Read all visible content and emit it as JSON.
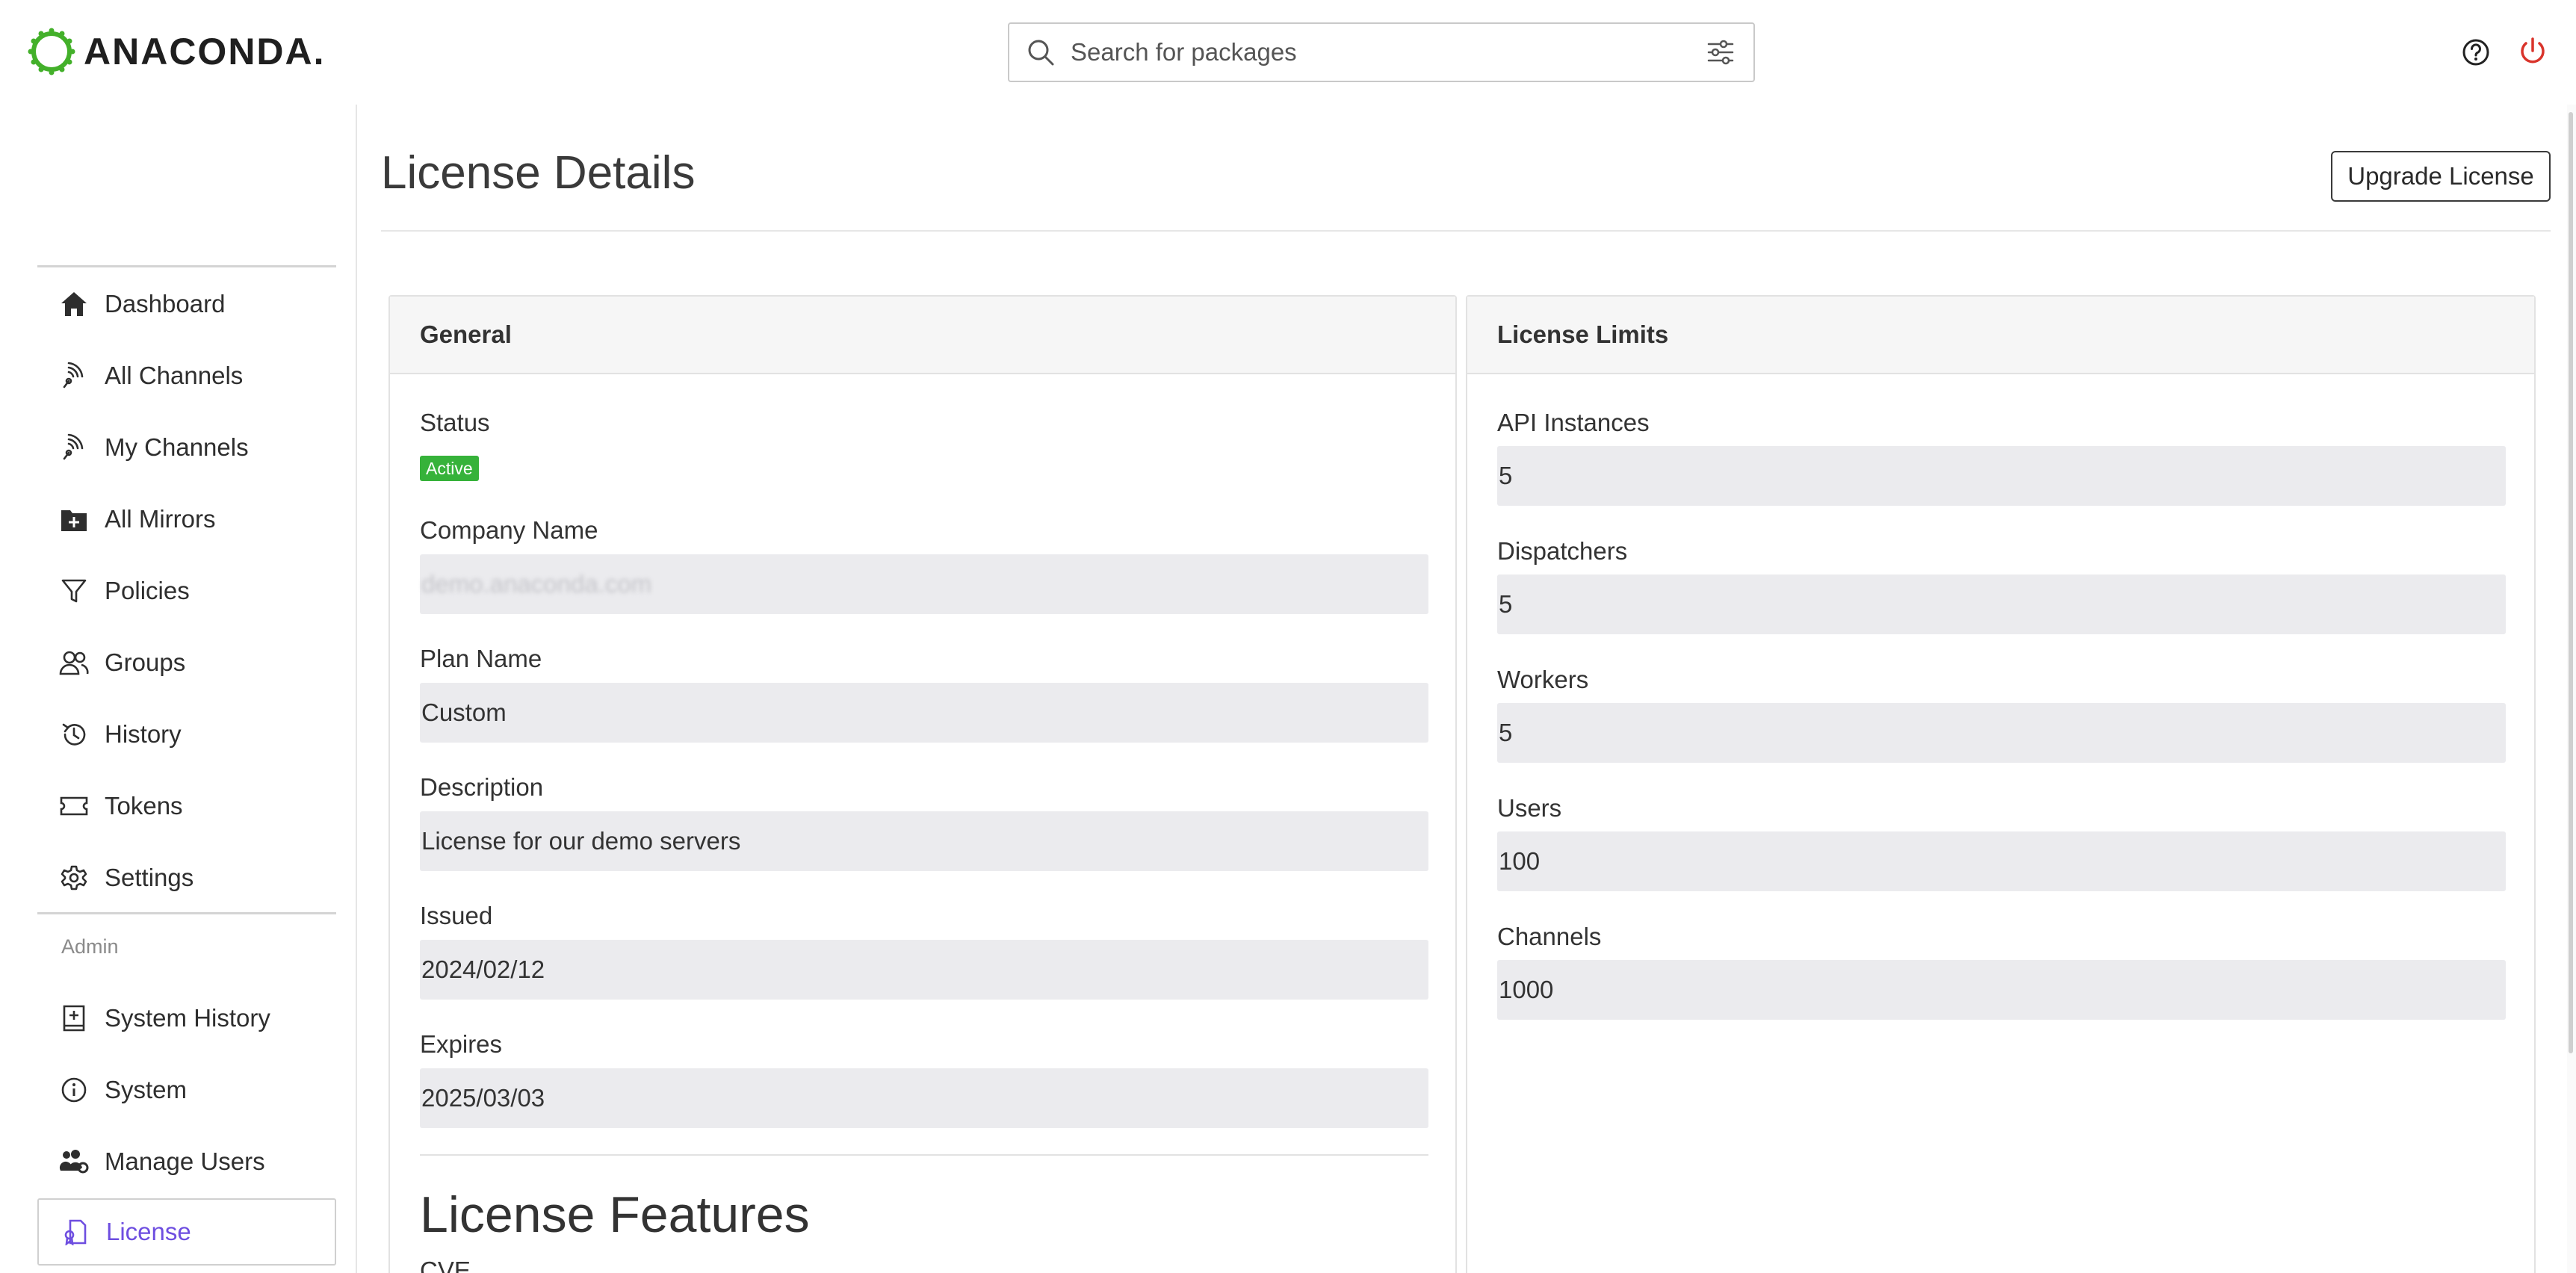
{
  "header": {
    "logo_text": "ANACONDA.",
    "search_placeholder": "Search for packages",
    "icons": {
      "search": "search-icon",
      "filter": "sliders-icon",
      "help": "help-circle-icon",
      "power": "power-icon"
    },
    "power_color": "#d9342b"
  },
  "sidebar": {
    "items": [
      {
        "label": "Dashboard",
        "icon": "home-icon"
      },
      {
        "label": "All Channels",
        "icon": "antenna-icon"
      },
      {
        "label": "My Channels",
        "icon": "antenna-icon"
      },
      {
        "label": "All Mirrors",
        "icon": "folder-plus-icon"
      },
      {
        "label": "Policies",
        "icon": "filter-icon"
      },
      {
        "label": "Groups",
        "icon": "users-icon"
      },
      {
        "label": "History",
        "icon": "history-icon"
      },
      {
        "label": "Tokens",
        "icon": "ticket-icon"
      },
      {
        "label": "Settings",
        "icon": "gear-icon"
      }
    ],
    "admin_label": "Admin",
    "admin_items": [
      {
        "label": "System History",
        "icon": "book-plus-icon"
      },
      {
        "label": "System",
        "icon": "info-icon"
      },
      {
        "label": "Manage Users",
        "icon": "users-cog-icon"
      },
      {
        "label": "License",
        "icon": "license-icon",
        "active": true
      }
    ],
    "active_color": "#6e4ee0"
  },
  "main": {
    "title": "License Details",
    "upgrade_button": "Upgrade License",
    "general": {
      "heading": "General",
      "status_label": "Status",
      "status_badge": "Active",
      "badge_color": "#36b23a",
      "company_label": "Company Name",
      "company_value": "demo.anaconda.com",
      "plan_label": "Plan Name",
      "plan_value": "Custom",
      "description_label": "Description",
      "description_value": "License for our demo servers",
      "issued_label": "Issued",
      "issued_value": "2024/02/12",
      "expires_label": "Expires",
      "expires_value": "2025/03/03"
    },
    "features": {
      "title": "License Features",
      "first_item": "CVE"
    },
    "limits": {
      "heading": "License Limits",
      "api_label": "API Instances",
      "api_value": "5",
      "dispatchers_label": "Dispatchers",
      "dispatchers_value": "5",
      "workers_label": "Workers",
      "workers_value": "5",
      "users_label": "Users",
      "users_value": "100",
      "channels_label": "Channels",
      "channels_value": "1000"
    }
  }
}
